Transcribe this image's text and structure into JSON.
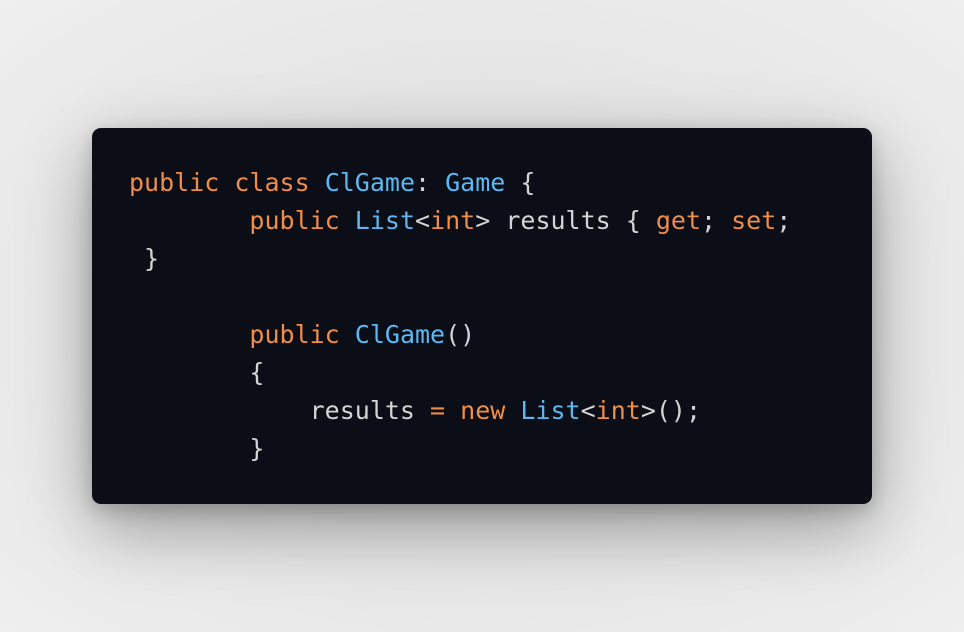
{
  "colors": {
    "background": "#e6e6e6",
    "card": "#0b0e16",
    "keyword": "#f08d49",
    "type": "#5cb8f2",
    "text": "#d4d4d4"
  },
  "code": {
    "language": "csharp",
    "lines": [
      [
        {
          "t": "public",
          "k": "kw"
        },
        {
          "t": " ",
          "k": "tx"
        },
        {
          "t": "class",
          "k": "kw"
        },
        {
          "t": " ",
          "k": "tx"
        },
        {
          "t": "ClGame",
          "k": "ty"
        },
        {
          "t": ": ",
          "k": "tx"
        },
        {
          "t": "Game",
          "k": "ty"
        },
        {
          "t": " {",
          "k": "tx"
        }
      ],
      [
        {
          "t": "        ",
          "k": "tx"
        },
        {
          "t": "public",
          "k": "kw"
        },
        {
          "t": " ",
          "k": "tx"
        },
        {
          "t": "List",
          "k": "ty"
        },
        {
          "t": "<",
          "k": "tx"
        },
        {
          "t": "int",
          "k": "kw"
        },
        {
          "t": "> results { ",
          "k": "tx"
        },
        {
          "t": "get",
          "k": "kw"
        },
        {
          "t": "; ",
          "k": "tx"
        },
        {
          "t": "set",
          "k": "kw"
        },
        {
          "t": ";",
          "k": "tx"
        }
      ],
      [
        {
          "t": " }",
          "k": "tx"
        }
      ],
      [],
      [
        {
          "t": "        ",
          "k": "tx"
        },
        {
          "t": "public",
          "k": "kw"
        },
        {
          "t": " ",
          "k": "tx"
        },
        {
          "t": "ClGame",
          "k": "ty"
        },
        {
          "t": "()",
          "k": "tx"
        }
      ],
      [
        {
          "t": "        {",
          "k": "tx"
        }
      ],
      [
        {
          "t": "            results ",
          "k": "tx"
        },
        {
          "t": "=",
          "k": "kw"
        },
        {
          "t": " ",
          "k": "tx"
        },
        {
          "t": "new",
          "k": "kw"
        },
        {
          "t": " ",
          "k": "tx"
        },
        {
          "t": "List",
          "k": "ty"
        },
        {
          "t": "<",
          "k": "tx"
        },
        {
          "t": "int",
          "k": "kw"
        },
        {
          "t": ">();",
          "k": "tx"
        }
      ],
      [
        {
          "t": "        }",
          "k": "tx"
        }
      ]
    ]
  }
}
